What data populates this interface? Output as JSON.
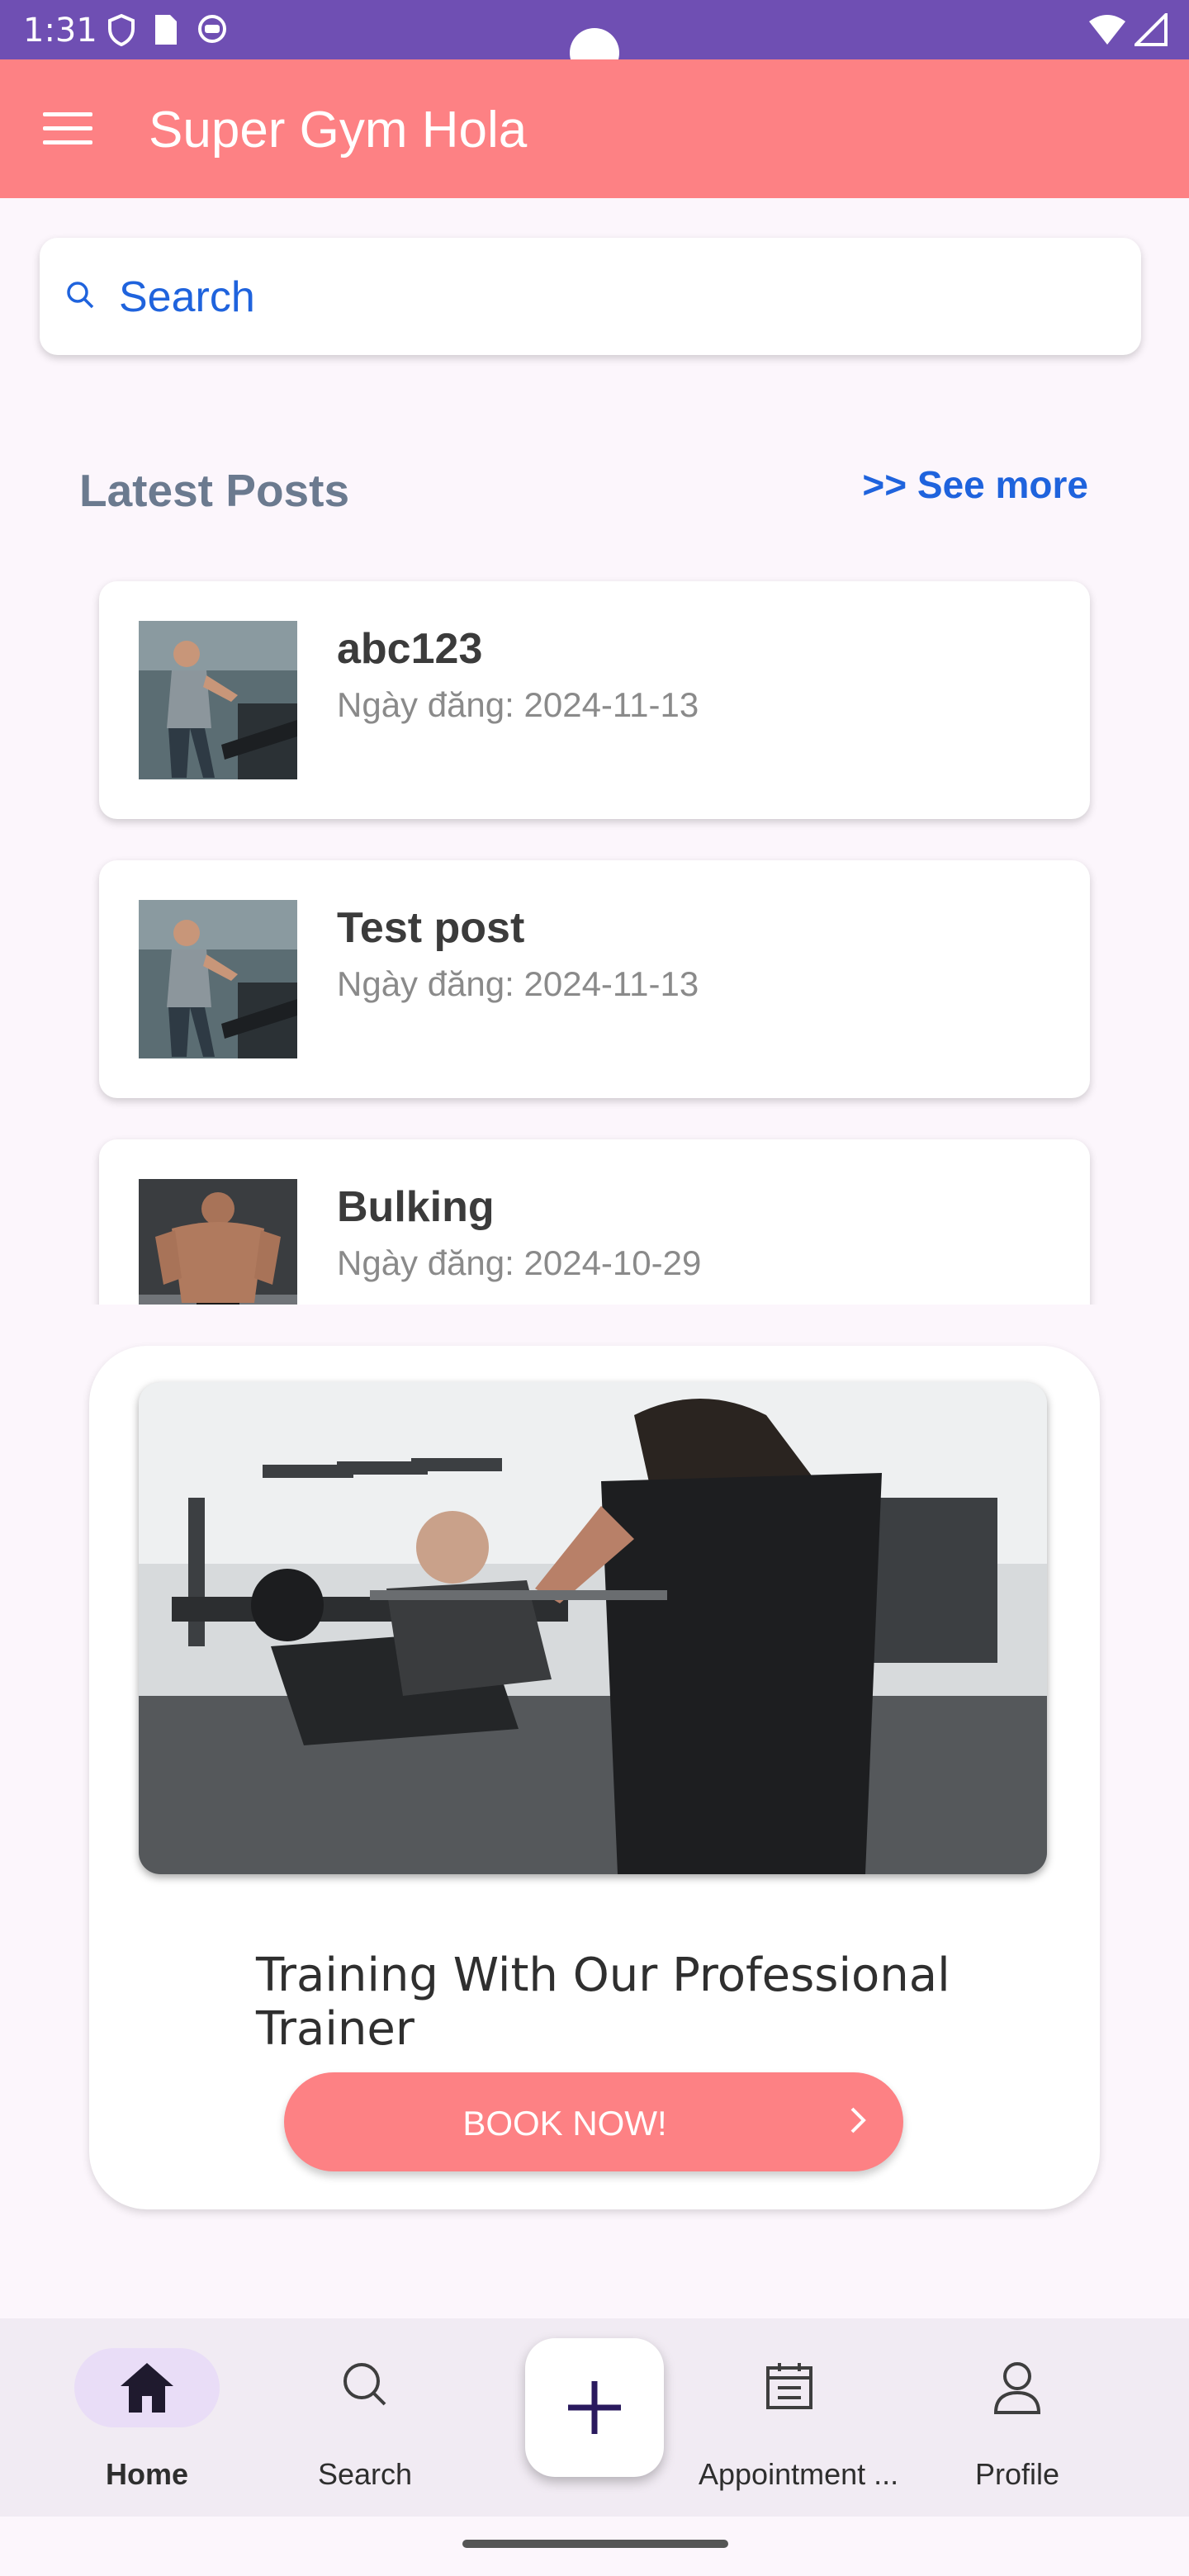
{
  "status_bar": {
    "time": "1:31"
  },
  "app_bar": {
    "title": "Super Gym Hola"
  },
  "search": {
    "placeholder": "Search"
  },
  "latest_posts": {
    "title": "Latest Posts",
    "see_more": ">> See more",
    "items": [
      {
        "title": "abc123",
        "date": "Ngày đăng: 2024-11-13",
        "thumb": "runner-treadmill"
      },
      {
        "title": "Test post",
        "date": "Ngày đăng: 2024-11-13",
        "thumb": "runner-treadmill"
      },
      {
        "title": "Bulking",
        "date": "Ngày đăng: 2024-10-29",
        "thumb": "bodybuilder"
      }
    ]
  },
  "promo": {
    "text": "Training With Our Professional Trainer",
    "button": "BOOK NOW!"
  },
  "bottom_nav": {
    "items": [
      {
        "label": "Home",
        "icon": "home-icon",
        "active": true
      },
      {
        "label": "Search",
        "icon": "search-icon",
        "active": false
      },
      {
        "label": "Appointment ...",
        "icon": "calendar-icon",
        "active": false
      },
      {
        "label": "Profile",
        "icon": "profile-icon",
        "active": false
      }
    ],
    "fab_icon": "plus-icon"
  },
  "colors": {
    "status_bar": "#6f4fb3",
    "app_bar": "#fd8184",
    "accent_blue": "#1f63dd",
    "background": "#fcf6fc",
    "nav_active_pill": "#e9ddf7"
  }
}
